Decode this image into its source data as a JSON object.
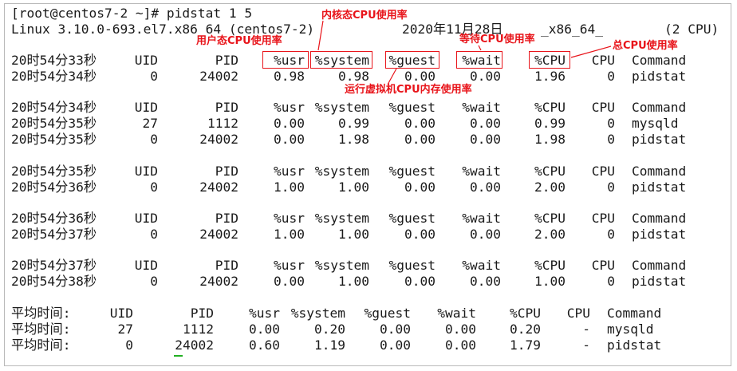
{
  "terminal": {
    "prompt_line": "[root@centos7-2 ~]# pidstat 1 5",
    "sysinfo": {
      "kernel": "Linux 3.10.0-693.el7.x86_64 (centos7-2)",
      "date": "2020年11月28日",
      "arch": "_x86_64_",
      "cpus": "(2 CPU)"
    },
    "header": {
      "uid": "UID",
      "pid": "PID",
      "usr": "%usr",
      "system": "%system",
      "guest": "%guest",
      "wait": "%wait",
      "cpu_pct": "%CPU",
      "cpu": "CPU",
      "command": "Command"
    },
    "blocks": [
      {
        "header_time": "20时54分33秒",
        "rows": [
          {
            "time": "20时54分34秒",
            "uid": "0",
            "pid": "24002",
            "usr": "0.98",
            "system": "0.98",
            "guest": "0.00",
            "wait": "0.00",
            "cpu_pct": "1.96",
            "cpu": "0",
            "command": "pidstat"
          }
        ]
      },
      {
        "header_time": "20时54分34秒",
        "rows": [
          {
            "time": "20时54分35秒",
            "uid": "27",
            "pid": "1112",
            "usr": "0.00",
            "system": "0.99",
            "guest": "0.00",
            "wait": "0.00",
            "cpu_pct": "0.99",
            "cpu": "0",
            "command": "mysqld"
          },
          {
            "time": "20时54分35秒",
            "uid": "0",
            "pid": "24002",
            "usr": "0.00",
            "system": "1.98",
            "guest": "0.00",
            "wait": "0.00",
            "cpu_pct": "1.98",
            "cpu": "0",
            "command": "pidstat"
          }
        ]
      },
      {
        "header_time": "20时54分35秒",
        "rows": [
          {
            "time": "20时54分36秒",
            "uid": "0",
            "pid": "24002",
            "usr": "1.00",
            "system": "1.00",
            "guest": "0.00",
            "wait": "0.00",
            "cpu_pct": "2.00",
            "cpu": "0",
            "command": "pidstat"
          }
        ]
      },
      {
        "header_time": "20时54分36秒",
        "rows": [
          {
            "time": "20时54分37秒",
            "uid": "0",
            "pid": "24002",
            "usr": "1.00",
            "system": "1.00",
            "guest": "0.00",
            "wait": "0.00",
            "cpu_pct": "2.00",
            "cpu": "0",
            "command": "pidstat"
          }
        ]
      },
      {
        "header_time": "20时54分37秒",
        "rows": [
          {
            "time": "20时54分38秒",
            "uid": "0",
            "pid": "24002",
            "usr": "0.00",
            "system": "1.00",
            "guest": "0.00",
            "wait": "0.00",
            "cpu_pct": "1.00",
            "cpu": "0",
            "command": "pidstat"
          }
        ]
      }
    ],
    "average": {
      "header_label": "平均时间:",
      "rows": [
        {
          "label": "平均时间:",
          "uid": "27",
          "pid": "1112",
          "usr": "0.00",
          "system": "0.20",
          "guest": "0.00",
          "wait": "0.00",
          "cpu_pct": "0.20",
          "cpu": "-",
          "command": "mysqld"
        },
        {
          "label": "平均时间:",
          "uid": "0",
          "pid": "24002",
          "usr": "0.60",
          "system": "1.19",
          "guest": "0.00",
          "wait": "0.00",
          "cpu_pct": "1.79",
          "cpu": "-",
          "command": "pidstat"
        }
      ]
    }
  },
  "annotations": {
    "kernel_cpu": "内核态CPU使用率",
    "user_cpu": "用户态CPU使用率",
    "wait_cpu": "等待CPU使用率",
    "total_cpu": "总CPU使用率",
    "guest_cpu": "运行虚拟机CPU内存使用率",
    "color": "#e8141a"
  }
}
